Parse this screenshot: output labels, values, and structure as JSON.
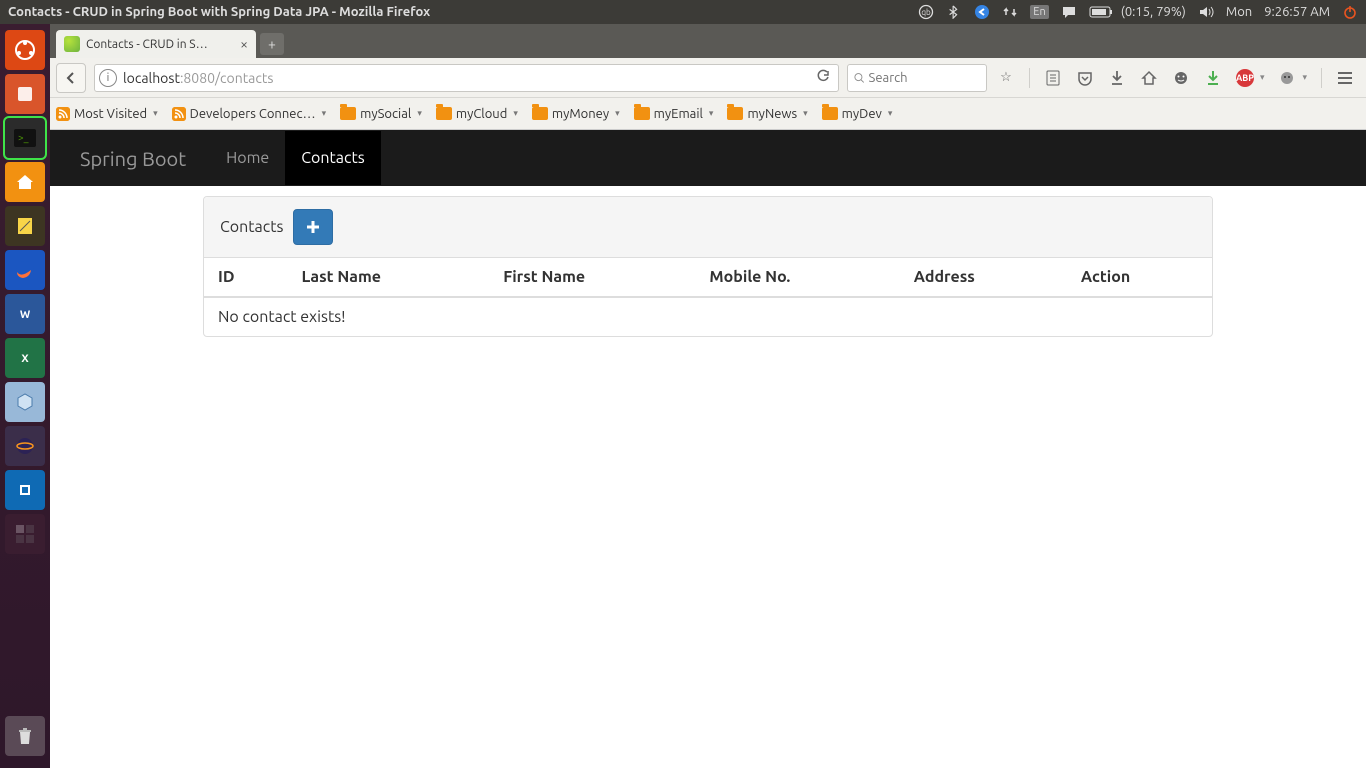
{
  "menubar": {
    "window_title": "Contacts - CRUD in Spring Boot with Spring Data JPA - Mozilla Firefox",
    "battery": "(0:15, 79%)",
    "day": "Mon",
    "time": "9:26:57 AM",
    "lang": "En"
  },
  "browser": {
    "tab_label": "Contacts - CRUD in S…",
    "url_host": "localhost",
    "url_rest": ":8080/contacts",
    "search_placeholder": "Search"
  },
  "bookmarks": [
    {
      "label": "Most Visited",
      "kind": "rss"
    },
    {
      "label": "Developers Connec…",
      "kind": "rss"
    },
    {
      "label": "mySocial",
      "kind": "folder"
    },
    {
      "label": "myCloud",
      "kind": "folder"
    },
    {
      "label": "myMoney",
      "kind": "folder"
    },
    {
      "label": "myEmail",
      "kind": "folder"
    },
    {
      "label": "myNews",
      "kind": "folder"
    },
    {
      "label": "myDev",
      "kind": "folder"
    }
  ],
  "site": {
    "brand": "Spring Boot",
    "nav": [
      {
        "label": "Home",
        "active": false
      },
      {
        "label": "Contacts",
        "active": true
      }
    ],
    "panel_title": "Contacts",
    "columns": [
      "ID",
      "Last Name",
      "First Name",
      "Mobile No.",
      "Address",
      "Action"
    ],
    "empty_message": "No contact exists!"
  }
}
